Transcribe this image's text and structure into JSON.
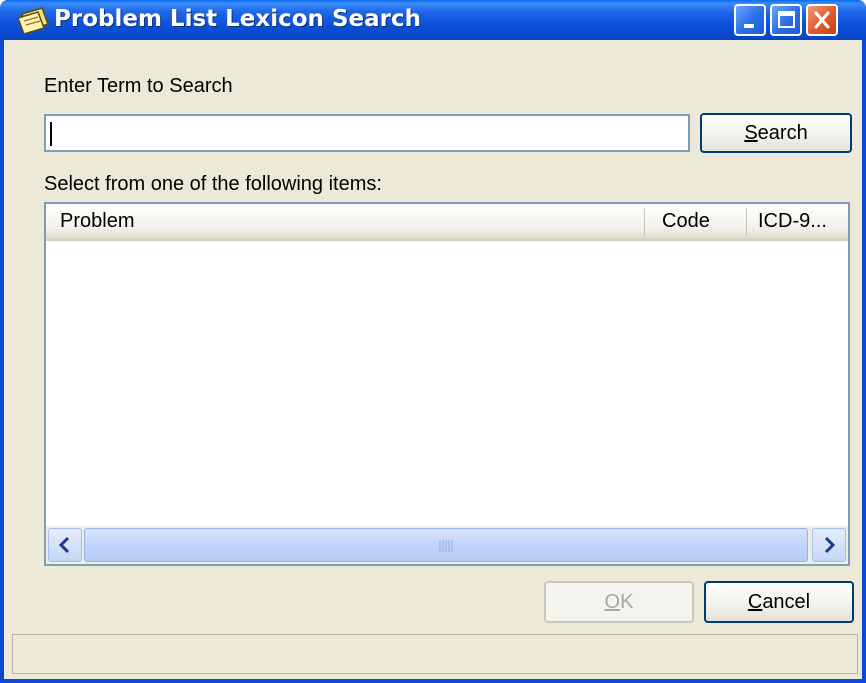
{
  "window": {
    "title": "Problem List  Lexicon Search",
    "colors": {
      "titlebar": "#0A50D8",
      "face": "#ECE9D8",
      "close": "#E05A2C"
    }
  },
  "search": {
    "label": "Enter Term to Search",
    "value": "",
    "button": {
      "accel": "S",
      "rest": "earch"
    }
  },
  "results": {
    "label": "Select from one of the following items:",
    "columns": [
      "Problem",
      "Code",
      "ICD-9..."
    ],
    "rows": []
  },
  "icons": {
    "title": "notepad-icon",
    "minimize": "minimize-icon",
    "maximize": "maximize-icon",
    "close": "close-icon",
    "scroll_left": "chevron-left-icon",
    "scroll_right": "chevron-right-icon"
  },
  "footer": {
    "ok": {
      "accel": "O",
      "rest": "K",
      "enabled": false
    },
    "cancel": {
      "accel": "C",
      "rest": "ancel"
    }
  },
  "status": ""
}
